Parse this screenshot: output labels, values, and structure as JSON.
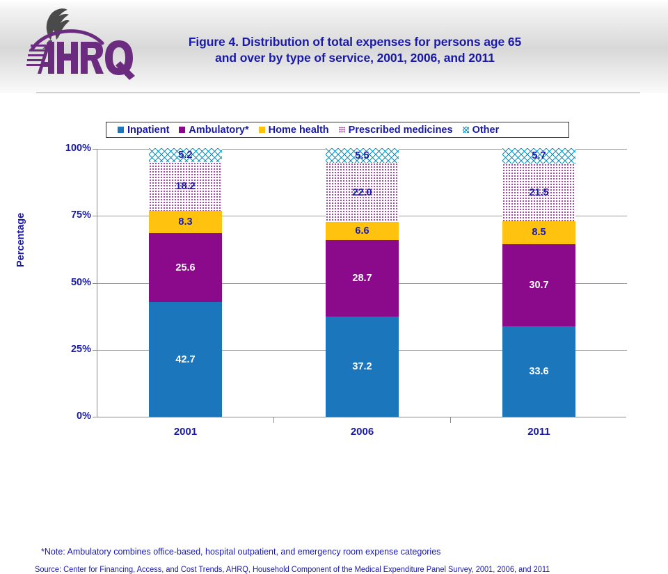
{
  "header": {
    "title_line1": "Figure 4. Distribution of total expenses for persons age 65",
    "title_line2": "and over by type of service, 2001, 2006, and 2011",
    "logo_alt": "AHRQ",
    "logo_wordmark": "AHRQ",
    "hhs_eagle_alt": "hhs-eagle"
  },
  "legend": {
    "items": [
      {
        "label": "Inpatient",
        "swatch": "sw-inpatient",
        "color": "#1b76bc"
      },
      {
        "label": "Ambulatory*",
        "swatch": "sw-ambulatory",
        "color": "#8b0a8b"
      },
      {
        "label": "Home health",
        "swatch": "sw-homehealth",
        "color": "#ffc20e"
      },
      {
        "label": "Prescribed medicines",
        "swatch": "sw-rx",
        "color": "#8b0a8b"
      },
      {
        "label": "Other",
        "swatch": "sw-other",
        "color": "#0e8fb5"
      }
    ]
  },
  "axes": {
    "y_title": "Percentage",
    "y_ticks": [
      "100%",
      "75%",
      "50%",
      "25%",
      "0%"
    ],
    "x_categories": [
      "2001",
      "2006",
      "2011"
    ]
  },
  "values": {
    "y2001": {
      "inpatient": "42.7",
      "ambulatory": "25.6",
      "home_health": "8.3",
      "rx": "18.2",
      "other": "5.2"
    },
    "y2006": {
      "inpatient": "37.2",
      "ambulatory": "28.7",
      "home_health": "6.6",
      "rx": "22.0",
      "other": "5.5"
    },
    "y2011": {
      "inpatient": "33.6",
      "ambulatory": "30.7",
      "home_health": "8.5",
      "rx": "21.5",
      "other": "5.7"
    }
  },
  "footnotes": {
    "note": "*Note: Ambulatory combines office-based, hospital outpatient, and emergency room expense categories",
    "source": "Source: Center for Financing, Access, and Cost Trends, AHRQ, Household Component of the Medical Expenditure Panel Survey,  2001, 2006, and 2011"
  },
  "chart_data": {
    "type": "bar",
    "stacked": true,
    "stack_mode": "percent",
    "title": "Figure 4. Distribution of total expenses for persons age 65 and over by type of service, 2001, 2006, and 2011",
    "xlabel": "",
    "ylabel": "Percentage",
    "categories": [
      "2001",
      "2006",
      "2011"
    ],
    "ylim": [
      0,
      100
    ],
    "yticks": [
      0,
      25,
      50,
      75,
      100
    ],
    "ytick_labels": [
      "0%",
      "25%",
      "50%",
      "75%",
      "100%"
    ],
    "grid": true,
    "legend_position": "top",
    "series": [
      {
        "name": "Inpatient",
        "color": "#1b76bc",
        "values": [
          42.7,
          37.2,
          33.6
        ]
      },
      {
        "name": "Ambulatory*",
        "color": "#8b0a8b",
        "values": [
          25.6,
          28.7,
          30.7
        ]
      },
      {
        "name": "Home health",
        "color": "#ffc20e",
        "values": [
          8.3,
          6.6,
          8.5
        ]
      },
      {
        "name": "Prescribed medicines",
        "color": "#8b0a8b",
        "pattern": "dots",
        "values": [
          18.2,
          22.0,
          21.5
        ]
      },
      {
        "name": "Other",
        "color": "#0e8fb5",
        "pattern": "crosshatch",
        "values": [
          5.2,
          5.5,
          5.7
        ]
      }
    ],
    "annotations": [
      "*Note: Ambulatory combines office-based, hospital outpatient, and emergency room expense categories",
      "Source: Center for Financing, Access, and Cost Trends, AHRQ, Household Component of the Medical Expenditure Panel Survey,  2001, 2006, and 2011"
    ]
  }
}
